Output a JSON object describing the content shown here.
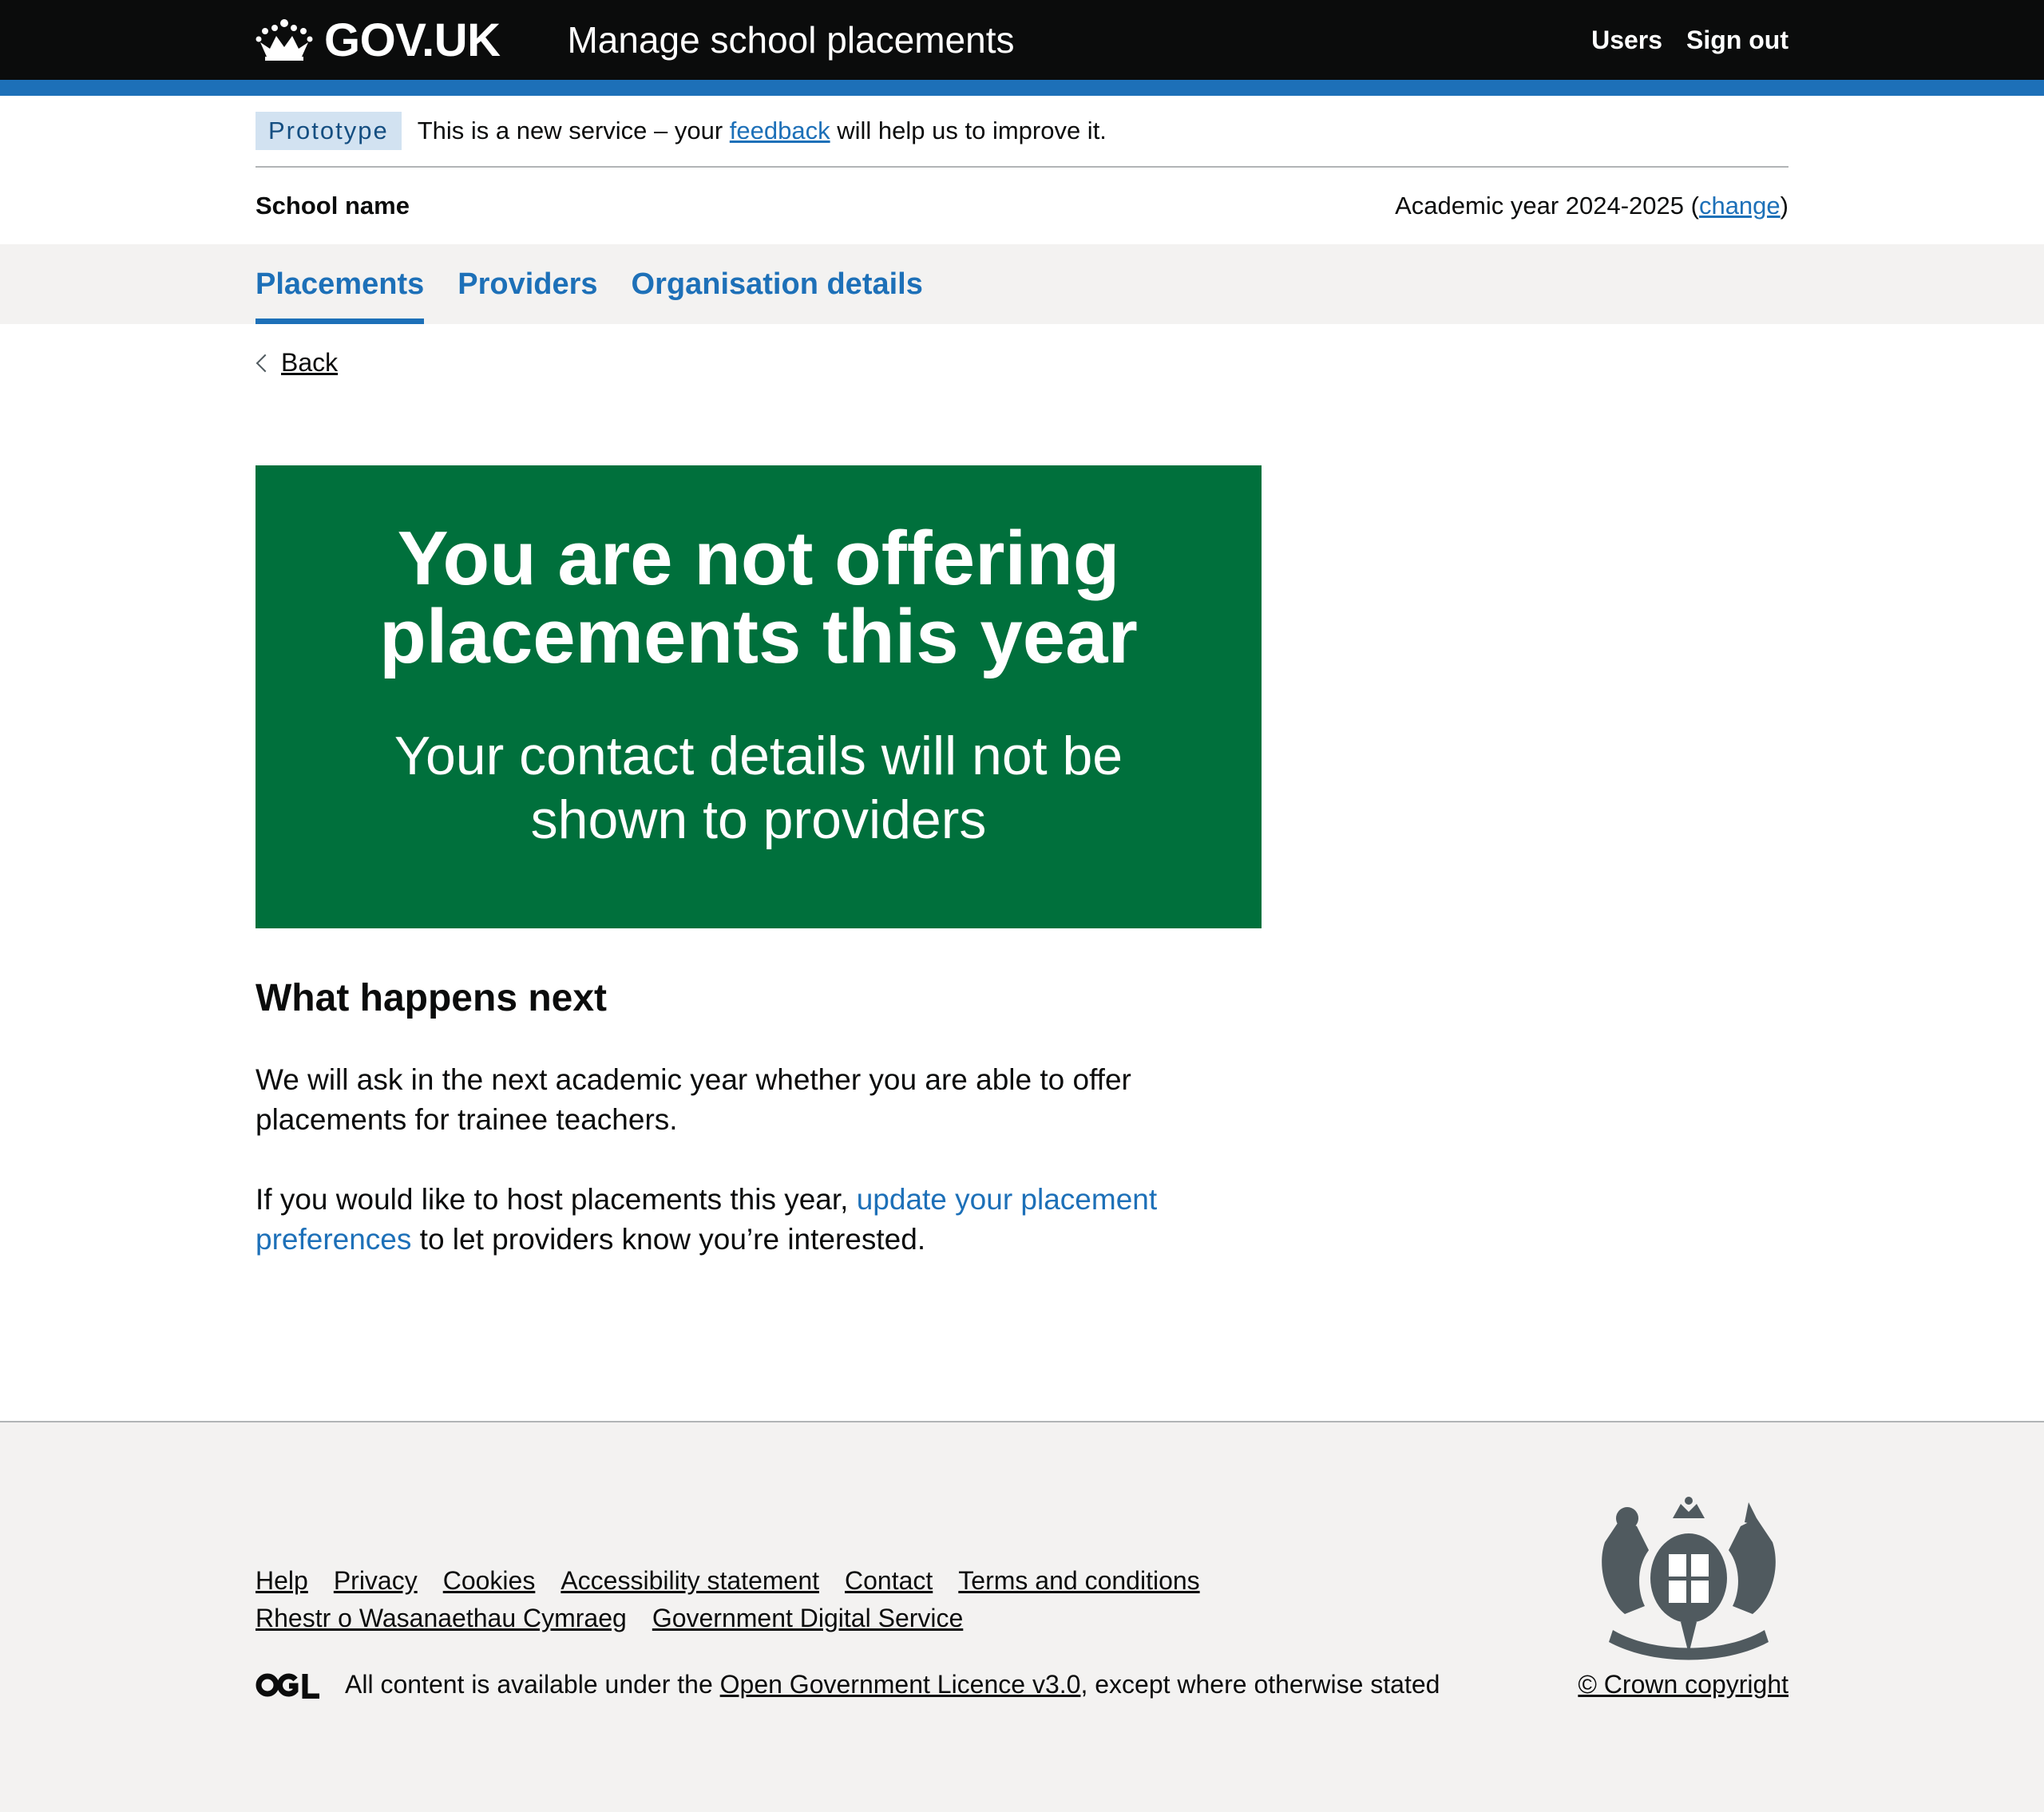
{
  "header": {
    "logo_text": "GOV.UK",
    "service_name": "Manage school placements",
    "nav": [
      "Users",
      "Sign out"
    ]
  },
  "phase_banner": {
    "tag": "Prototype",
    "text_before": "This is a new service – your ",
    "link": "feedback",
    "text_after": " will help us to improve it."
  },
  "school": {
    "name": "School name",
    "year_text": "Academic year 2024-2025 (",
    "change_link": "change",
    "year_close": ")"
  },
  "tabs": [
    "Placements",
    "Providers",
    "Organisation details"
  ],
  "back_link": "Back",
  "panel": {
    "title": "You are not offering placements this year",
    "body": "Your contact details will not be shown to providers"
  },
  "content": {
    "heading": "What happens next",
    "para1": "We will ask in the next academic year whether you are able to offer placements for trainee teachers.",
    "para2_before": "If you would like to host placements this year, ",
    "para2_link": "update your placement preferences",
    "para2_after": " to let providers know you’re interested."
  },
  "footer": {
    "links": [
      "Help",
      "Privacy",
      "Cookies",
      "Accessibility statement",
      "Contact",
      "Terms and conditions",
      "Rhestr o Wasanaethau Cymraeg",
      "Government Digital Service"
    ],
    "licence_before": "All content is available under the ",
    "licence_link": "Open Government Licence v3.0",
    "licence_after": ", except where otherwise stated",
    "copyright": "© Crown copyright",
    "ogl_label": "OGL"
  },
  "colors": {
    "header_bg": "#0b0c0c",
    "brand_blue": "#1d70b8",
    "panel_green": "#00703c",
    "footer_bg": "#f3f2f1"
  }
}
